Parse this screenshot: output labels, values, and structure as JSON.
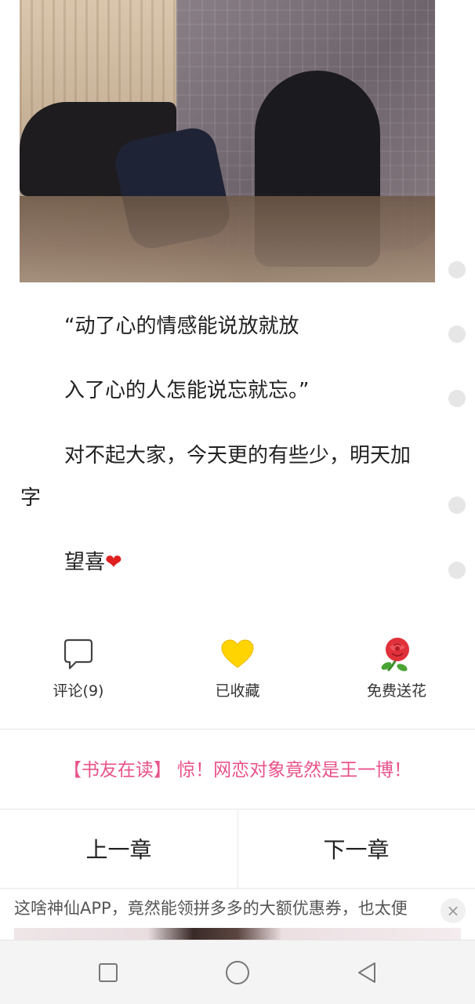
{
  "paragraphs": [
    "“动了心的情感能说放就放",
    "入了心的人怎能说忘就忘。”",
    "对不起大家，今天更的有些少，明天加字",
    "望喜"
  ],
  "heart_emoji": "❤",
  "actions": {
    "comment": {
      "label": "评论(9)",
      "icon": "speech-bubble-icon"
    },
    "collect": {
      "label": "已收藏",
      "icon": "heart-icon",
      "color": "#FFD400"
    },
    "flower": {
      "label": "免费送花",
      "icon": "rose-icon",
      "color": "#E0303A"
    }
  },
  "promo": "【书友在读】 惊！网恋对象竟然是王一博！",
  "chapter_nav": {
    "prev": "上一章",
    "next": "下一章"
  },
  "ad": {
    "text": "这啥神仙APP，竟然能领拼多多的大额优惠券，也太便",
    "close": "×"
  },
  "system_nav": {
    "recent": "square-icon",
    "home": "circle-icon",
    "back": "triangle-back-icon"
  },
  "colors": {
    "promo": "#E8528A",
    "scroll_dot": "#E6E6E6"
  }
}
